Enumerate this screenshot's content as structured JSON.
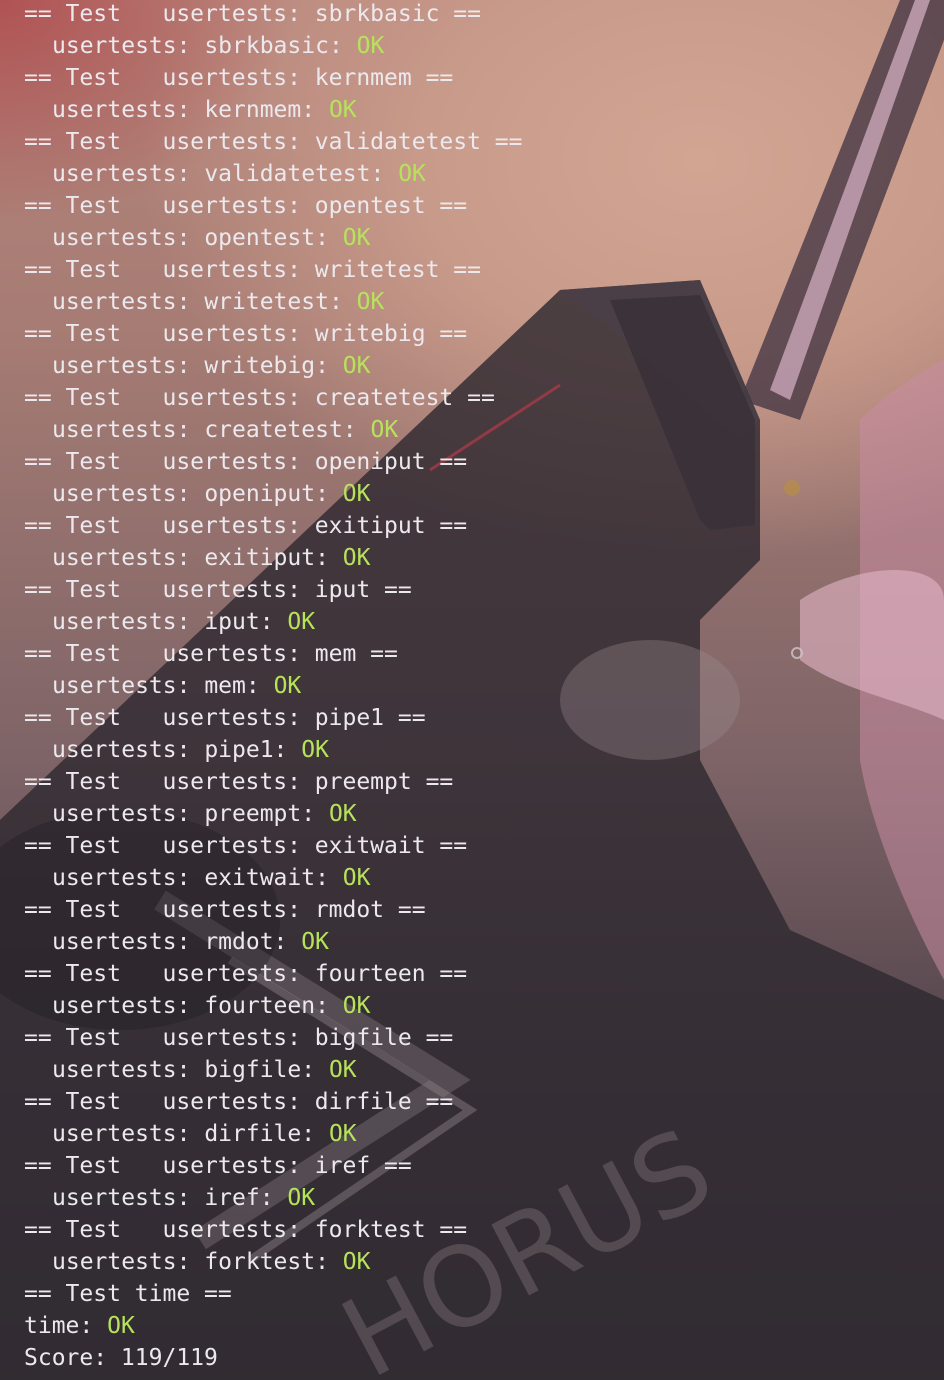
{
  "colors": {
    "terminal_text": "#ece9ee",
    "ok_text": "#b6e35a"
  },
  "terminal": {
    "lines": [
      {
        "text": "== Test   usertests: sbrkbasic ==",
        "status": "",
        "indent": false
      },
      {
        "text": "usertests: sbrkbasic: ",
        "status": "OK",
        "indent": true
      },
      {
        "text": "== Test   usertests: kernmem ==",
        "status": "",
        "indent": false
      },
      {
        "text": "usertests: kernmem: ",
        "status": "OK",
        "indent": true
      },
      {
        "text": "== Test   usertests: validatetest ==",
        "status": "",
        "indent": false
      },
      {
        "text": "usertests: validatetest: ",
        "status": "OK",
        "indent": true
      },
      {
        "text": "== Test   usertests: opentest ==",
        "status": "",
        "indent": false
      },
      {
        "text": "usertests: opentest: ",
        "status": "OK",
        "indent": true
      },
      {
        "text": "== Test   usertests: writetest ==",
        "status": "",
        "indent": false
      },
      {
        "text": "usertests: writetest: ",
        "status": "OK",
        "indent": true
      },
      {
        "text": "== Test   usertests: writebig ==",
        "status": "",
        "indent": false
      },
      {
        "text": "usertests: writebig: ",
        "status": "OK",
        "indent": true
      },
      {
        "text": "== Test   usertests: createtest ==",
        "status": "",
        "indent": false
      },
      {
        "text": "usertests: createtest: ",
        "status": "OK",
        "indent": true
      },
      {
        "text": "== Test   usertests: openiput ==",
        "status": "",
        "indent": false
      },
      {
        "text": "usertests: openiput: ",
        "status": "OK",
        "indent": true
      },
      {
        "text": "== Test   usertests: exitiput ==",
        "status": "",
        "indent": false
      },
      {
        "text": "usertests: exitiput: ",
        "status": "OK",
        "indent": true
      },
      {
        "text": "== Test   usertests: iput ==",
        "status": "",
        "indent": false
      },
      {
        "text": "usertests: iput: ",
        "status": "OK",
        "indent": true
      },
      {
        "text": "== Test   usertests: mem ==",
        "status": "",
        "indent": false
      },
      {
        "text": "usertests: mem: ",
        "status": "OK",
        "indent": true
      },
      {
        "text": "== Test   usertests: pipe1 ==",
        "status": "",
        "indent": false
      },
      {
        "text": "usertests: pipe1: ",
        "status": "OK",
        "indent": true
      },
      {
        "text": "== Test   usertests: preempt ==",
        "status": "",
        "indent": false
      },
      {
        "text": "usertests: preempt: ",
        "status": "OK",
        "indent": true
      },
      {
        "text": "== Test   usertests: exitwait ==",
        "status": "",
        "indent": false
      },
      {
        "text": "usertests: exitwait: ",
        "status": "OK",
        "indent": true
      },
      {
        "text": "== Test   usertests: rmdot ==",
        "status": "",
        "indent": false
      },
      {
        "text": "usertests: rmdot: ",
        "status": "OK",
        "indent": true
      },
      {
        "text": "== Test   usertests: fourteen ==",
        "status": "",
        "indent": false
      },
      {
        "text": "usertests: fourteen: ",
        "status": "OK",
        "indent": true
      },
      {
        "text": "== Test   usertests: bigfile ==",
        "status": "",
        "indent": false
      },
      {
        "text": "usertests: bigfile: ",
        "status": "OK",
        "indent": true
      },
      {
        "text": "== Test   usertests: dirfile ==",
        "status": "",
        "indent": false
      },
      {
        "text": "usertests: dirfile: ",
        "status": "OK",
        "indent": true
      },
      {
        "text": "== Test   usertests: iref ==",
        "status": "",
        "indent": false
      },
      {
        "text": "usertests: iref: ",
        "status": "OK",
        "indent": true
      },
      {
        "text": "== Test   usertests: forktest ==",
        "status": "",
        "indent": false
      },
      {
        "text": "usertests: forktest: ",
        "status": "OK",
        "indent": true
      },
      {
        "text": "== Test time ==",
        "status": "",
        "indent": false
      },
      {
        "text": "time: ",
        "status": "OK",
        "indent": false
      },
      {
        "text": "Score: 119/119",
        "status": "",
        "indent": false
      }
    ]
  },
  "wallpaper": {
    "logo_text": "HORUS"
  }
}
